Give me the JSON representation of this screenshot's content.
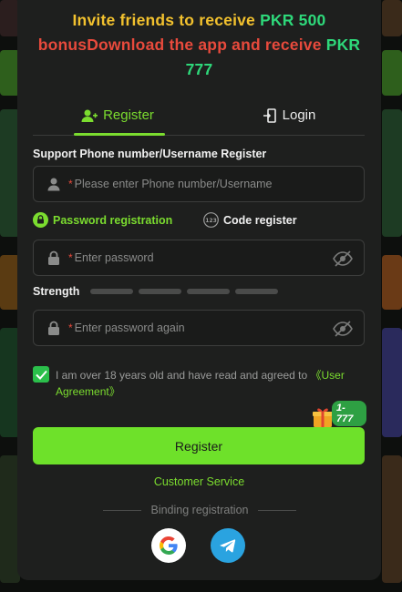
{
  "promo": {
    "part1": "Invite friends to receive ",
    "amount1": "PKR 500",
    "part2": "bonusDownload the app and receive ",
    "amount2": "PKR 777"
  },
  "tabs": {
    "register_label": "Register",
    "login_label": "Login"
  },
  "form": {
    "account_label": "Support Phone number/Username Register",
    "account_placeholder": "Please enter Phone number/Username",
    "mode_password": "Password registration",
    "mode_code": "Code register",
    "password_placeholder": "Enter password",
    "strength_label": "Strength",
    "confirm_placeholder": "Enter password again",
    "agreement_text": "I am over 18 years old and have read and agreed to ",
    "agreement_link": "《User Agreement》",
    "agreement_checked": true
  },
  "gift": {
    "badge": "1-777"
  },
  "actions": {
    "register_button": "Register",
    "customer_service": "Customer Service",
    "binding_label": "Binding registration"
  },
  "colors": {
    "accent": "#7bdc2f",
    "button": "#6ee12a",
    "required": "#e84a3c",
    "checkbox": "#2bbf4b"
  },
  "icons": {
    "register_tab": "add-user-icon",
    "login_tab": "login-door-icon",
    "account": "user-icon",
    "lock": "lock-icon",
    "eye_hidden": "eye-off-icon",
    "google": "google-icon",
    "telegram": "telegram-icon"
  }
}
